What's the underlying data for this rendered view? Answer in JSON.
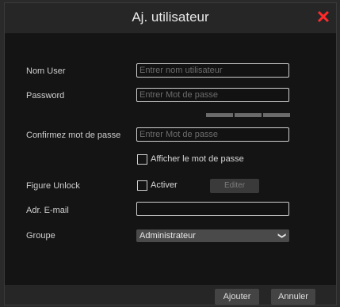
{
  "dialog": {
    "title": "Aj. utilisateur"
  },
  "form": {
    "username": {
      "label": "Nom User",
      "placeholder": "Entrer nom utilisateur",
      "value": ""
    },
    "password": {
      "label": "Password",
      "placeholder": "Entrer Mot de passe",
      "value": ""
    },
    "confirm": {
      "label": "Confirmez mot de passe",
      "placeholder": "Entrer Mot de passe",
      "value": ""
    },
    "show_password": {
      "label": "Afficher le mot de passe",
      "checked": false
    },
    "figure_unlock": {
      "label": "Figure Unlock",
      "activate_label": "Activer",
      "edit_label": "Editer"
    },
    "email": {
      "label": "Adr. E-mail",
      "value": ""
    },
    "group": {
      "label": "Groupe",
      "selected": "Administrateur"
    }
  },
  "footer": {
    "add_label": "Ajouter",
    "cancel_label": "Annuler"
  },
  "colors": {
    "close": "#ff2b2b",
    "background": "#141414",
    "titlebar": "#262626"
  },
  "icons": {
    "close": "close-icon",
    "dropdown": "chevron-down-icon"
  }
}
